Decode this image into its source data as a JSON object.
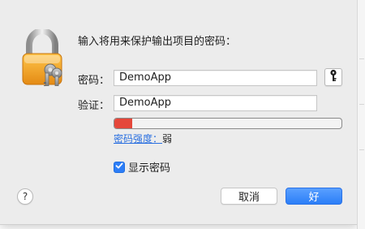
{
  "dialog": {
    "title": "输入将用来保护输出项目的密码：",
    "password": {
      "label": "密码：",
      "value": "DemoApp"
    },
    "verify": {
      "label": "验证：",
      "value": "DemoApp"
    },
    "strength": {
      "link_label": "密码强度：",
      "value_label": "弱",
      "meter_fraction": 0.08,
      "meter_color": "#e5473a"
    },
    "show_password": {
      "label": "显示密码",
      "checked": true
    },
    "buttons": {
      "help": "?",
      "cancel": "取消",
      "ok": "好"
    }
  },
  "icons": {
    "lock": "lock-icon",
    "key": "key-icon",
    "checkmark": "checkmark-icon"
  },
  "colors": {
    "accent": "#2d7ef7",
    "link": "#2a6fe0",
    "lock_body": "#f2a12a"
  }
}
